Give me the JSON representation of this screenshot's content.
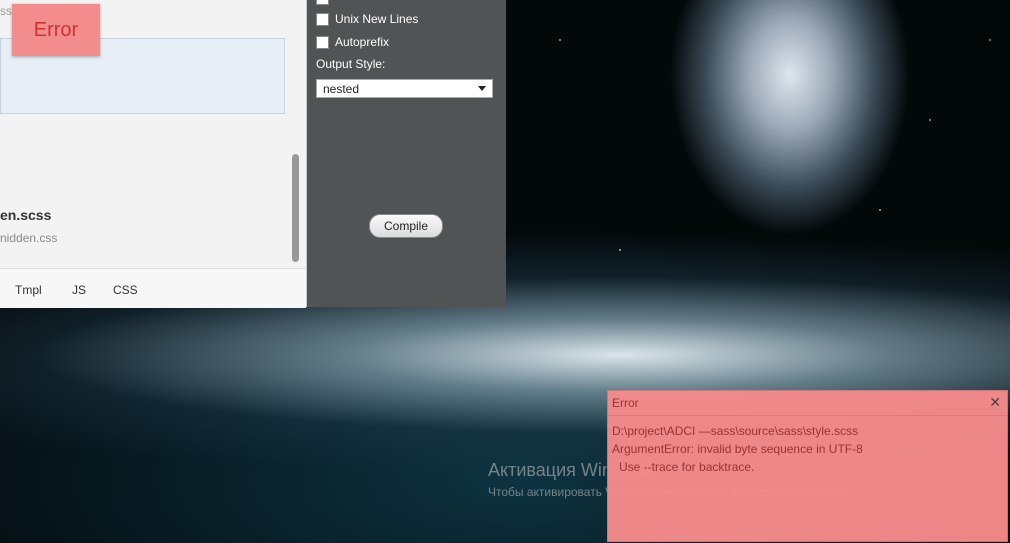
{
  "app": {
    "file_tail_top": "ss",
    "error_toast": "Error",
    "file_name": "en.scss",
    "file_path": "nidden.css",
    "bottom_tabs": [
      "Tmpl",
      "JS",
      "CSS"
    ]
  },
  "settings": {
    "checkboxes": [
      {
        "label": "Unix New Lines",
        "checked": false
      },
      {
        "label": "Autoprefix",
        "checked": false
      }
    ],
    "output_style_label": "Output Style:",
    "output_style_value": "nested",
    "compile_label": "Compile"
  },
  "watermark": {
    "title": "Активация Windows",
    "subtitle": "Чтобы активировать Windows, перейдите в раздел \"Параметры\"."
  },
  "error_dialog": {
    "title": "Error",
    "close_glyph": "✕",
    "lines": [
      "D:\\project\\ADCI —sass\\source\\sass\\style.scss",
      "ArgumentError: invalid byte sequence in UTF-8",
      "Use --trace for backtrace."
    ]
  },
  "colors": {
    "error_bg": "#f68a8a",
    "panel_bg": "#515455",
    "editor_bg": "#e8eef6"
  }
}
